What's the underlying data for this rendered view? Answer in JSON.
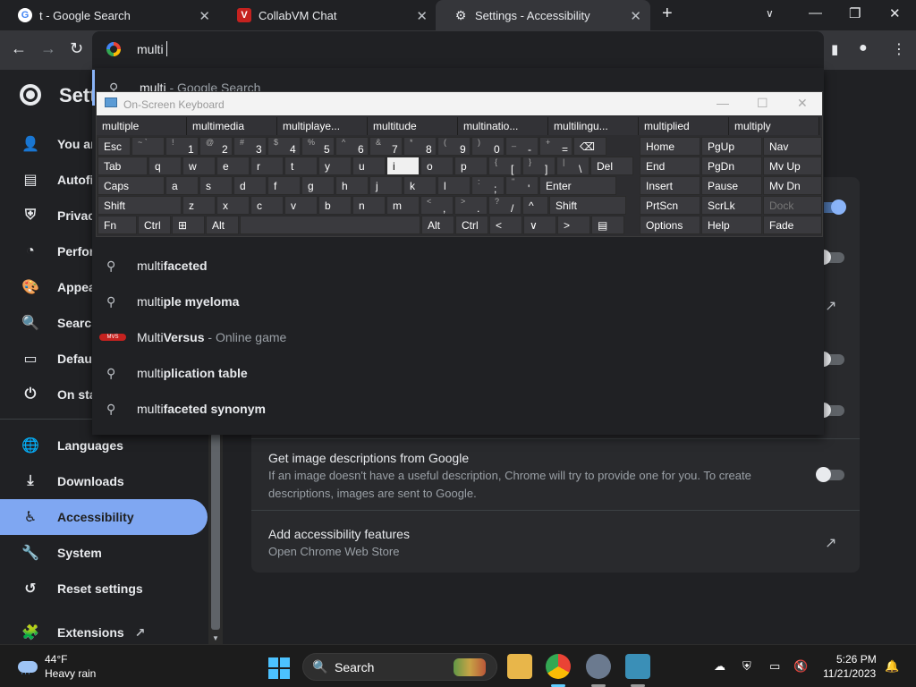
{
  "tabs": [
    {
      "title": "t - Google Search",
      "icon": "google-icon"
    },
    {
      "title": "CollabVM Chat",
      "icon": "collabvm-icon"
    },
    {
      "title": "Settings - Accessibility",
      "icon": "gear-icon"
    }
  ],
  "omnibox": {
    "value": "multi"
  },
  "settings": {
    "title": "Settings",
    "sidebar": [
      {
        "label": "You and Google",
        "icon": "person-icon"
      },
      {
        "label": "Autofill and passwords",
        "icon": "clipboard-icon"
      },
      {
        "label": "Privacy and security",
        "icon": "shield-icon"
      },
      {
        "label": "Performance",
        "icon": "speedometer-icon"
      },
      {
        "label": "Appearance",
        "icon": "palette-icon"
      },
      {
        "label": "Search engine",
        "icon": "search-icon"
      },
      {
        "label": "Default browser",
        "icon": "browser-icon"
      },
      {
        "label": "On startup",
        "icon": "power-icon"
      },
      {
        "label": "Languages",
        "icon": "globe-icon"
      },
      {
        "label": "Downloads",
        "icon": "download-icon"
      },
      {
        "label": "Accessibility",
        "icon": "accessibility-icon"
      },
      {
        "label": "System",
        "icon": "wrench-icon"
      },
      {
        "label": "Reset settings",
        "icon": "history-icon"
      },
      {
        "label": "Extensions",
        "icon": "puzzle-icon"
      }
    ],
    "image_descriptions": {
      "title": "Get image descriptions from Google",
      "desc_line1": "If an image doesn't have a useful description, Chrome will try to provide one for you. To create",
      "desc_line2": "descriptions, images are sent to Google."
    },
    "add_features": {
      "title": "Add accessibility features",
      "subtitle": "Open Chrome Web Store"
    }
  },
  "suggestions": [
    {
      "prefix": "multi",
      "rest": " - Google Search",
      "kind": "search"
    },
    {
      "prefix": "multi",
      "rest": "faceted",
      "kind": "search"
    },
    {
      "prefix": "multi",
      "rest": "ple myeloma",
      "kind": "search"
    },
    {
      "prefix": "Multi",
      "rest": "Versus",
      "extra": " - Online game",
      "kind": "entity"
    },
    {
      "prefix": "multi",
      "rest": "plication table",
      "kind": "search"
    },
    {
      "prefix": "multi",
      "rest": "faceted synonym",
      "kind": "search"
    }
  ],
  "osk": {
    "title": "On-Screen Keyboard",
    "predictions": [
      "multiple",
      "multimedia",
      "multiplaye...",
      "multitude",
      "multinatio...",
      "multilingu...",
      "multiplied",
      "multiply"
    ],
    "row1": [
      {
        "lo": "Esc"
      },
      {
        "sh": "~ `",
        "lo": ""
      },
      {
        "sh": "!",
        "ba": "1"
      },
      {
        "sh": "@",
        "ba": "2"
      },
      {
        "sh": "#",
        "ba": "3"
      },
      {
        "sh": "$",
        "ba": "4"
      },
      {
        "sh": "%",
        "ba": "5"
      },
      {
        "sh": "^",
        "ba": "6"
      },
      {
        "sh": "&",
        "ba": "7"
      },
      {
        "sh": "*",
        "ba": "8"
      },
      {
        "sh": "(",
        "ba": "9"
      },
      {
        "sh": ")",
        "ba": "0"
      },
      {
        "sh": "_",
        "ba": "-"
      },
      {
        "sh": "+",
        "ba": "="
      },
      {
        "lo": "⌫"
      }
    ],
    "row2": [
      {
        "lo": "Tab"
      },
      {
        "lo": "q"
      },
      {
        "lo": "w"
      },
      {
        "lo": "e"
      },
      {
        "lo": "r"
      },
      {
        "lo": "t"
      },
      {
        "lo": "y"
      },
      {
        "lo": "u"
      },
      {
        "lo": "i"
      },
      {
        "lo": "o"
      },
      {
        "lo": "p"
      },
      {
        "sh": "{",
        "ba": "["
      },
      {
        "sh": "}",
        "ba": "]"
      },
      {
        "sh": "|",
        "ba": "\\"
      },
      {
        "lo": "Del"
      }
    ],
    "row3": [
      {
        "lo": "Caps"
      },
      {
        "lo": "a"
      },
      {
        "lo": "s"
      },
      {
        "lo": "d"
      },
      {
        "lo": "f"
      },
      {
        "lo": "g"
      },
      {
        "lo": "h"
      },
      {
        "lo": "j"
      },
      {
        "lo": "k"
      },
      {
        "lo": "l"
      },
      {
        "sh": ":",
        "ba": ";"
      },
      {
        "sh": "\"",
        "ba": "'"
      },
      {
        "lo": "Enter"
      }
    ],
    "row4": [
      {
        "lo": "Shift"
      },
      {
        "lo": "z"
      },
      {
        "lo": "x"
      },
      {
        "lo": "c"
      },
      {
        "lo": "v"
      },
      {
        "lo": "b"
      },
      {
        "lo": "n"
      },
      {
        "lo": "m"
      },
      {
        "sh": "<",
        "ba": ","
      },
      {
        "sh": ">",
        "ba": "."
      },
      {
        "sh": "?",
        "ba": "/"
      },
      {
        "lo": "^"
      },
      {
        "lo": "Shift"
      }
    ],
    "row5": [
      {
        "lo": "Fn"
      },
      {
        "lo": "Ctrl"
      },
      {
        "lo": "⊞"
      },
      {
        "lo": "Alt"
      },
      {
        "lo": ""
      },
      {
        "lo": "Alt"
      },
      {
        "lo": "Ctrl"
      },
      {
        "lo": "<"
      },
      {
        "lo": "∨"
      },
      {
        "lo": ">"
      },
      {
        "lo": "▤"
      }
    ],
    "nav": [
      [
        "Home",
        "PgUp",
        "Nav"
      ],
      [
        "End",
        "PgDn",
        "Mv Up"
      ],
      [
        "Insert",
        "Pause",
        "Mv Dn"
      ],
      [
        "PrtScn",
        "ScrLk",
        "Dock"
      ],
      [
        "Options",
        "Help",
        "Fade"
      ]
    ]
  },
  "taskbar": {
    "weather_temp": "44°F",
    "weather_cond": "Heavy rain",
    "search_label": "Search",
    "time": "5:26 PM",
    "date": "11/21/2023"
  }
}
